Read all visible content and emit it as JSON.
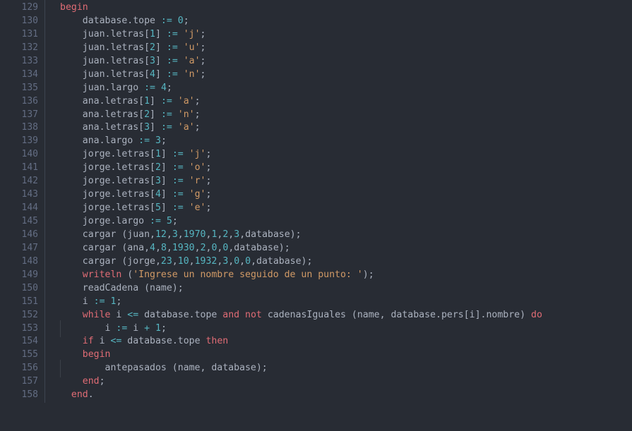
{
  "editor": {
    "language": "Pascal",
    "theme": "one-dark",
    "background": "#282c34",
    "gutter_background": "#282c34",
    "gutter_rule_color": "#3e4451",
    "indent_guide_color": "#3b4048",
    "line_number_color": "#636d83",
    "first_line": 129,
    "last_line": 158,
    "colors": {
      "keyword": "#e06c75",
      "number": "#56b6c2",
      "string": "#d19a66",
      "operator": "#56b6c2",
      "identifier": "#abb2bf",
      "punctuation": "#abb2bf"
    }
  },
  "lines": [
    {
      "n": "129",
      "indent": 0,
      "guides": 0,
      "tokens": [
        {
          "t": "kw",
          "v": "begin"
        }
      ]
    },
    {
      "n": "130",
      "indent": 4,
      "guides": 0,
      "tokens": [
        {
          "t": "id",
          "v": "database.tope "
        },
        {
          "t": "op",
          "v": ":="
        },
        {
          "t": "id",
          "v": " "
        },
        {
          "t": "num",
          "v": "0"
        },
        {
          "t": "pun",
          "v": ";"
        }
      ]
    },
    {
      "n": "131",
      "indent": 4,
      "guides": 0,
      "tokens": [
        {
          "t": "id",
          "v": "juan.letras["
        },
        {
          "t": "num",
          "v": "1"
        },
        {
          "t": "id",
          "v": "] "
        },
        {
          "t": "op",
          "v": ":="
        },
        {
          "t": "id",
          "v": " "
        },
        {
          "t": "str",
          "v": "'j'"
        },
        {
          "t": "pun",
          "v": ";"
        }
      ]
    },
    {
      "n": "132",
      "indent": 4,
      "guides": 0,
      "tokens": [
        {
          "t": "id",
          "v": "juan.letras["
        },
        {
          "t": "num",
          "v": "2"
        },
        {
          "t": "id",
          "v": "] "
        },
        {
          "t": "op",
          "v": ":="
        },
        {
          "t": "id",
          "v": " "
        },
        {
          "t": "str",
          "v": "'u'"
        },
        {
          "t": "pun",
          "v": ";"
        }
      ]
    },
    {
      "n": "133",
      "indent": 4,
      "guides": 0,
      "tokens": [
        {
          "t": "id",
          "v": "juan.letras["
        },
        {
          "t": "num",
          "v": "3"
        },
        {
          "t": "id",
          "v": "] "
        },
        {
          "t": "op",
          "v": ":="
        },
        {
          "t": "id",
          "v": " "
        },
        {
          "t": "str",
          "v": "'a'"
        },
        {
          "t": "pun",
          "v": ";"
        }
      ]
    },
    {
      "n": "134",
      "indent": 4,
      "guides": 0,
      "tokens": [
        {
          "t": "id",
          "v": "juan.letras["
        },
        {
          "t": "num",
          "v": "4"
        },
        {
          "t": "id",
          "v": "] "
        },
        {
          "t": "op",
          "v": ":="
        },
        {
          "t": "id",
          "v": " "
        },
        {
          "t": "str",
          "v": "'n'"
        },
        {
          "t": "pun",
          "v": ";"
        }
      ]
    },
    {
      "n": "135",
      "indent": 4,
      "guides": 0,
      "tokens": [
        {
          "t": "id",
          "v": "juan.largo "
        },
        {
          "t": "op",
          "v": ":="
        },
        {
          "t": "id",
          "v": " "
        },
        {
          "t": "num",
          "v": "4"
        },
        {
          "t": "pun",
          "v": ";"
        }
      ]
    },
    {
      "n": "136",
      "indent": 4,
      "guides": 0,
      "tokens": [
        {
          "t": "id",
          "v": "ana.letras["
        },
        {
          "t": "num",
          "v": "1"
        },
        {
          "t": "id",
          "v": "] "
        },
        {
          "t": "op",
          "v": ":="
        },
        {
          "t": "id",
          "v": " "
        },
        {
          "t": "str",
          "v": "'a'"
        },
        {
          "t": "pun",
          "v": ";"
        }
      ]
    },
    {
      "n": "137",
      "indent": 4,
      "guides": 0,
      "tokens": [
        {
          "t": "id",
          "v": "ana.letras["
        },
        {
          "t": "num",
          "v": "2"
        },
        {
          "t": "id",
          "v": "] "
        },
        {
          "t": "op",
          "v": ":="
        },
        {
          "t": "id",
          "v": " "
        },
        {
          "t": "str",
          "v": "'n'"
        },
        {
          "t": "pun",
          "v": ";"
        }
      ]
    },
    {
      "n": "138",
      "indent": 4,
      "guides": 0,
      "tokens": [
        {
          "t": "id",
          "v": "ana.letras["
        },
        {
          "t": "num",
          "v": "3"
        },
        {
          "t": "id",
          "v": "] "
        },
        {
          "t": "op",
          "v": ":="
        },
        {
          "t": "id",
          "v": " "
        },
        {
          "t": "str",
          "v": "'a'"
        },
        {
          "t": "pun",
          "v": ";"
        }
      ]
    },
    {
      "n": "139",
      "indent": 4,
      "guides": 0,
      "tokens": [
        {
          "t": "id",
          "v": "ana.largo "
        },
        {
          "t": "op",
          "v": ":="
        },
        {
          "t": "id",
          "v": " "
        },
        {
          "t": "num",
          "v": "3"
        },
        {
          "t": "pun",
          "v": ";"
        }
      ]
    },
    {
      "n": "140",
      "indent": 4,
      "guides": 0,
      "tokens": [
        {
          "t": "id",
          "v": "jorge.letras["
        },
        {
          "t": "num",
          "v": "1"
        },
        {
          "t": "id",
          "v": "] "
        },
        {
          "t": "op",
          "v": ":="
        },
        {
          "t": "id",
          "v": " "
        },
        {
          "t": "str",
          "v": "'j'"
        },
        {
          "t": "pun",
          "v": ";"
        }
      ]
    },
    {
      "n": "141",
      "indent": 4,
      "guides": 0,
      "tokens": [
        {
          "t": "id",
          "v": "jorge.letras["
        },
        {
          "t": "num",
          "v": "2"
        },
        {
          "t": "id",
          "v": "] "
        },
        {
          "t": "op",
          "v": ":="
        },
        {
          "t": "id",
          "v": " "
        },
        {
          "t": "str",
          "v": "'o'"
        },
        {
          "t": "pun",
          "v": ";"
        }
      ]
    },
    {
      "n": "142",
      "indent": 4,
      "guides": 0,
      "tokens": [
        {
          "t": "id",
          "v": "jorge.letras["
        },
        {
          "t": "num",
          "v": "3"
        },
        {
          "t": "id",
          "v": "] "
        },
        {
          "t": "op",
          "v": ":="
        },
        {
          "t": "id",
          "v": " "
        },
        {
          "t": "str",
          "v": "'r'"
        },
        {
          "t": "pun",
          "v": ";"
        }
      ]
    },
    {
      "n": "143",
      "indent": 4,
      "guides": 0,
      "tokens": [
        {
          "t": "id",
          "v": "jorge.letras["
        },
        {
          "t": "num",
          "v": "4"
        },
        {
          "t": "id",
          "v": "] "
        },
        {
          "t": "op",
          "v": ":="
        },
        {
          "t": "id",
          "v": " "
        },
        {
          "t": "str",
          "v": "'g'"
        },
        {
          "t": "pun",
          "v": ";"
        }
      ]
    },
    {
      "n": "144",
      "indent": 4,
      "guides": 0,
      "tokens": [
        {
          "t": "id",
          "v": "jorge.letras["
        },
        {
          "t": "num",
          "v": "5"
        },
        {
          "t": "id",
          "v": "] "
        },
        {
          "t": "op",
          "v": ":="
        },
        {
          "t": "id",
          "v": " "
        },
        {
          "t": "str",
          "v": "'e'"
        },
        {
          "t": "pun",
          "v": ";"
        }
      ]
    },
    {
      "n": "145",
      "indent": 4,
      "guides": 0,
      "tokens": [
        {
          "t": "id",
          "v": "jorge.largo "
        },
        {
          "t": "op",
          "v": ":="
        },
        {
          "t": "id",
          "v": " "
        },
        {
          "t": "num",
          "v": "5"
        },
        {
          "t": "pun",
          "v": ";"
        }
      ]
    },
    {
      "n": "146",
      "indent": 4,
      "guides": 0,
      "tokens": [
        {
          "t": "id",
          "v": "cargar (juan,"
        },
        {
          "t": "num",
          "v": "12"
        },
        {
          "t": "pun",
          "v": ","
        },
        {
          "t": "num",
          "v": "3"
        },
        {
          "t": "pun",
          "v": ","
        },
        {
          "t": "num",
          "v": "1970"
        },
        {
          "t": "pun",
          "v": ","
        },
        {
          "t": "num",
          "v": "1"
        },
        {
          "t": "pun",
          "v": ","
        },
        {
          "t": "num",
          "v": "2"
        },
        {
          "t": "pun",
          "v": ","
        },
        {
          "t": "num",
          "v": "3"
        },
        {
          "t": "id",
          "v": ",database);"
        }
      ]
    },
    {
      "n": "147",
      "indent": 4,
      "guides": 0,
      "tokens": [
        {
          "t": "id",
          "v": "cargar (ana,"
        },
        {
          "t": "num",
          "v": "4"
        },
        {
          "t": "pun",
          "v": ","
        },
        {
          "t": "num",
          "v": "8"
        },
        {
          "t": "pun",
          "v": ","
        },
        {
          "t": "num",
          "v": "1930"
        },
        {
          "t": "pun",
          "v": ","
        },
        {
          "t": "num",
          "v": "2"
        },
        {
          "t": "pun",
          "v": ","
        },
        {
          "t": "num",
          "v": "0"
        },
        {
          "t": "pun",
          "v": ","
        },
        {
          "t": "num",
          "v": "0"
        },
        {
          "t": "id",
          "v": ",database);"
        }
      ]
    },
    {
      "n": "148",
      "indent": 4,
      "guides": 0,
      "tokens": [
        {
          "t": "id",
          "v": "cargar (jorge,"
        },
        {
          "t": "num",
          "v": "23"
        },
        {
          "t": "pun",
          "v": ","
        },
        {
          "t": "num",
          "v": "10"
        },
        {
          "t": "pun",
          "v": ","
        },
        {
          "t": "num",
          "v": "1932"
        },
        {
          "t": "pun",
          "v": ","
        },
        {
          "t": "num",
          "v": "3"
        },
        {
          "t": "pun",
          "v": ","
        },
        {
          "t": "num",
          "v": "0"
        },
        {
          "t": "pun",
          "v": ","
        },
        {
          "t": "num",
          "v": "0"
        },
        {
          "t": "id",
          "v": ",database);"
        }
      ]
    },
    {
      "n": "149",
      "indent": 4,
      "guides": 0,
      "tokens": [
        {
          "t": "kw",
          "v": "writeln"
        },
        {
          "t": "id",
          "v": " ("
        },
        {
          "t": "str",
          "v": "'Ingrese un nombre seguido de un punto: '"
        },
        {
          "t": "id",
          "v": ");"
        }
      ]
    },
    {
      "n": "150",
      "indent": 4,
      "guides": 0,
      "tokens": [
        {
          "t": "id",
          "v": "readCadena (name);"
        }
      ]
    },
    {
      "n": "151",
      "indent": 4,
      "guides": 0,
      "tokens": [
        {
          "t": "id",
          "v": "i "
        },
        {
          "t": "op",
          "v": ":="
        },
        {
          "t": "id",
          "v": " "
        },
        {
          "t": "num",
          "v": "1"
        },
        {
          "t": "pun",
          "v": ";"
        }
      ]
    },
    {
      "n": "152",
      "indent": 4,
      "guides": 0,
      "tokens": [
        {
          "t": "kw",
          "v": "while"
        },
        {
          "t": "id",
          "v": " i "
        },
        {
          "t": "op",
          "v": "<="
        },
        {
          "t": "id",
          "v": " database.tope "
        },
        {
          "t": "kw",
          "v": "and"
        },
        {
          "t": "id",
          "v": " "
        },
        {
          "t": "kw",
          "v": "not"
        },
        {
          "t": "id",
          "v": " cadenasIguales (name, database.pers["
        },
        {
          "t": "id",
          "v": "i"
        },
        {
          "t": "id",
          "v": "].nombre) "
        },
        {
          "t": "kw",
          "v": "do"
        }
      ]
    },
    {
      "n": "153",
      "indent": 8,
      "guides": 1,
      "tokens": [
        {
          "t": "id",
          "v": "i "
        },
        {
          "t": "op",
          "v": ":="
        },
        {
          "t": "id",
          "v": " i "
        },
        {
          "t": "op",
          "v": "+"
        },
        {
          "t": "id",
          "v": " "
        },
        {
          "t": "num",
          "v": "1"
        },
        {
          "t": "pun",
          "v": ";"
        }
      ]
    },
    {
      "n": "154",
      "indent": 4,
      "guides": 0,
      "tokens": [
        {
          "t": "kw",
          "v": "if"
        },
        {
          "t": "id",
          "v": " i "
        },
        {
          "t": "op",
          "v": "<="
        },
        {
          "t": "id",
          "v": " database.tope "
        },
        {
          "t": "kw",
          "v": "then"
        }
      ]
    },
    {
      "n": "155",
      "indent": 4,
      "guides": 0,
      "tokens": [
        {
          "t": "kw",
          "v": "begin"
        }
      ]
    },
    {
      "n": "156",
      "indent": 8,
      "guides": 1,
      "tokens": [
        {
          "t": "id",
          "v": "antepasados (name, database);"
        }
      ]
    },
    {
      "n": "157",
      "indent": 4,
      "guides": 0,
      "tokens": [
        {
          "t": "kw",
          "v": "end"
        },
        {
          "t": "pun",
          "v": ";"
        }
      ]
    },
    {
      "n": "158",
      "indent": 2,
      "guides": 0,
      "tokens": [
        {
          "t": "kw",
          "v": "end"
        },
        {
          "t": "pun",
          "v": "."
        }
      ]
    }
  ]
}
